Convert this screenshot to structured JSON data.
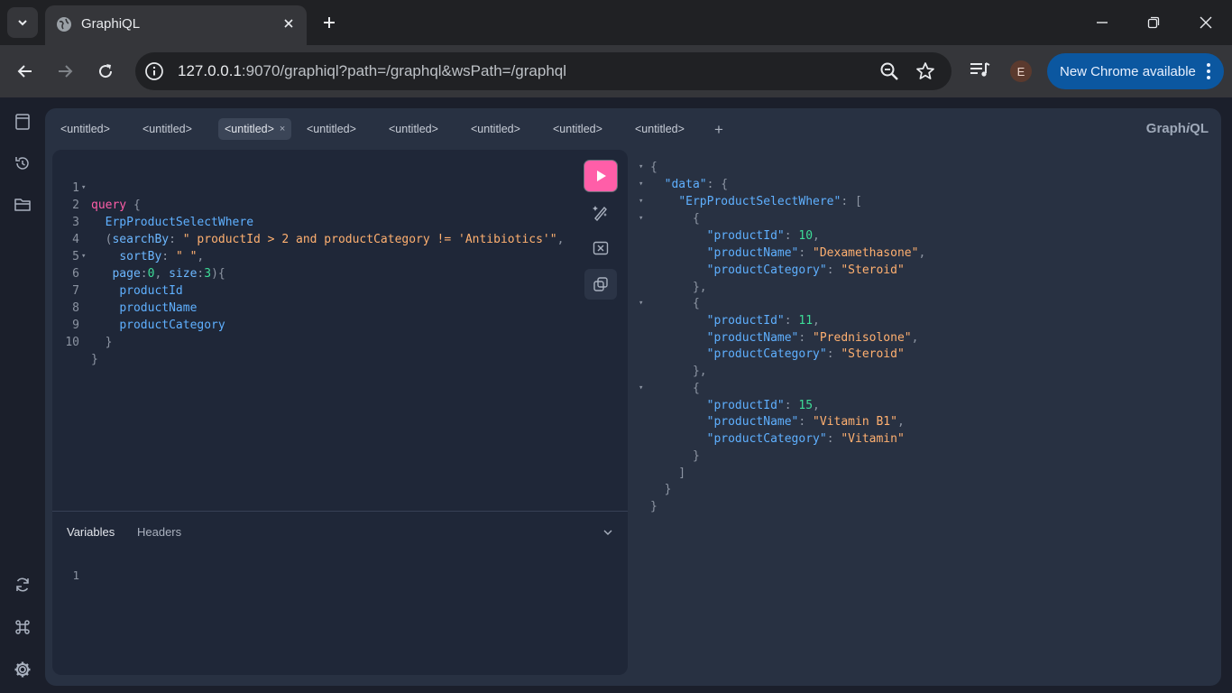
{
  "browser": {
    "tab_title": "GraphiQL",
    "url_host": "127.0.0.1",
    "url_rest": ":9070/graphiql?path=/graphql&wsPath=/graphql",
    "profile_initial": "E",
    "update_label": "New Chrome available"
  },
  "graphiql": {
    "logo_prefix": "Graph",
    "logo_italic": "i",
    "logo_suffix": "QL",
    "add_tab": "+",
    "session_tabs": [
      {
        "label": "<untitled>",
        "active": false
      },
      {
        "label": "<untitled>",
        "active": false
      },
      {
        "label": "<untitled>",
        "active": true
      },
      {
        "label": "<untitled>",
        "active": false
      },
      {
        "label": "<untitled>",
        "active": false
      },
      {
        "label": "<untitled>",
        "active": false
      },
      {
        "label": "<untitled>",
        "active": false
      },
      {
        "label": "<untitled>",
        "active": false
      }
    ],
    "close_tab": "×",
    "query_lines": [
      {
        "n": "1",
        "fold": true
      },
      {
        "n": "2",
        "fold": false
      },
      {
        "n": "3",
        "fold": false
      },
      {
        "n": "4",
        "fold": false
      },
      {
        "n": "5",
        "fold": true
      },
      {
        "n": "6",
        "fold": false
      },
      {
        "n": "7",
        "fold": false
      },
      {
        "n": "8",
        "fold": false
      },
      {
        "n": "9",
        "fold": false
      },
      {
        "n": "10",
        "fold": false
      }
    ],
    "query": {
      "kw": "query",
      "brace_open": " {",
      "op": "ErpProductSelectWhere",
      "search_arg": "searchBy",
      "search_val": "\" productId > 2 and productCategory != 'Antibiotics'\"",
      "sort_arg": "sortBy",
      "sort_val": "\" \"",
      "page_arg": "page",
      "page_val": "0",
      "size_arg": "size",
      "size_val": "3",
      "field1": "productId",
      "field2": "productName",
      "field3": "productCategory"
    },
    "variables_tab": "Variables",
    "headers_tab": "Headers",
    "variables_line": "1",
    "response": {
      "data_key": "\"data\"",
      "list_key": "\"ErpProductSelectWhere\"",
      "items": [
        {
          "id": "10",
          "name": "\"Dexamethasone\"",
          "category": "\"Steroid\""
        },
        {
          "id": "11",
          "name": "\"Prednisolone\"",
          "category": "\"Steroid\""
        },
        {
          "id": "15",
          "name": "\"Vitamin B1\"",
          "category": "\"Vitamin\""
        }
      ],
      "k_id": "\"productId\"",
      "k_name": "\"productName\"",
      "k_cat": "\"productCategory\""
    }
  },
  "colors": {
    "run_button": "#ff5ea8",
    "keyword": "#ff5ea8",
    "field": "#5fb0ff",
    "string": "#ffb070",
    "number": "#3ddc97",
    "update_button": "#0b57a0"
  },
  "icons": {
    "tab_search": "chevron-down-icon",
    "tab_favicon": "globe-icon",
    "docs": "docs-icon",
    "history": "history-icon",
    "explorer": "folder-icon",
    "refetch": "refresh-icon",
    "shortcuts": "command-icon",
    "settings": "gear-icon",
    "run": "play-icon",
    "prettify": "magic-wand-icon",
    "merge": "merge-icon",
    "copy": "copy-icon"
  }
}
